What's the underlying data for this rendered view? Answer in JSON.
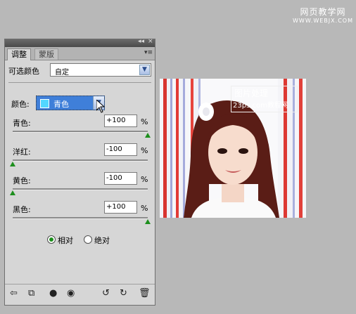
{
  "watermark": {
    "line1": "网页教学网",
    "line2": "WWW.WEBJX.COM"
  },
  "panel": {
    "tabs": [
      "调整",
      "蒙版"
    ],
    "preset_label": "可选颜色",
    "preset_value": "自定",
    "color_label": "颜色:",
    "color_value": "青色",
    "sliders": [
      {
        "label": "青色:",
        "value": "+100",
        "unit": "%",
        "level": 1.0
      },
      {
        "label": "洋红:",
        "value": "-100",
        "unit": "%",
        "level": 0.0
      },
      {
        "label": "黄色:",
        "value": "-100",
        "unit": "%",
        "level": 0.0
      },
      {
        "label": "黑色:",
        "value": "+100",
        "unit": "%",
        "level": 1.0
      }
    ],
    "method": {
      "relative": "相对",
      "absolute": "绝对",
      "selected": "relative"
    }
  },
  "photo_watermark": {
    "line1": "图片处理",
    "line2": "23ps.com教程网"
  },
  "colors": {
    "selected_swatch": "#52d7ff",
    "highlight": "#3f7fd9",
    "slider_thumb": "#1d8f1d"
  }
}
